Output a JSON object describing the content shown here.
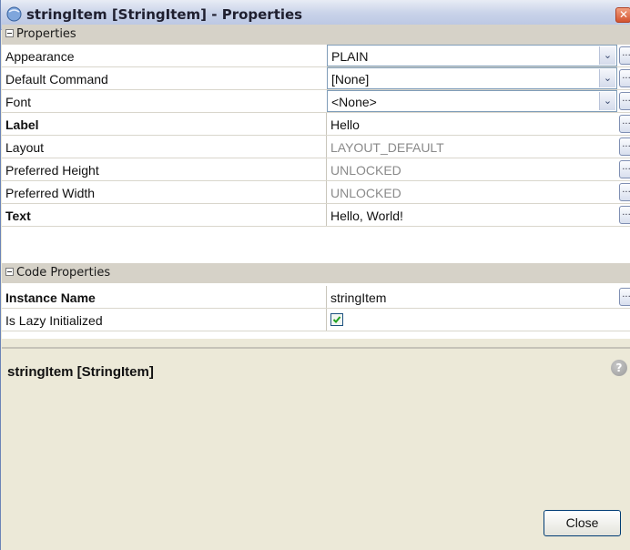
{
  "window": {
    "title": "stringItem [StringItem] - Properties",
    "close_glyph": "✕"
  },
  "sections": {
    "properties": "Properties",
    "code_properties": "Code Properties"
  },
  "properties": [
    {
      "name": "Appearance",
      "value": "PLAIN"
    },
    {
      "name": "Default Command",
      "value": "[None]"
    },
    {
      "name": "Font",
      "value": "<None>"
    },
    {
      "name": "Label",
      "value": "Hello"
    },
    {
      "name": "Layout",
      "value": "LAYOUT_DEFAULT"
    },
    {
      "name": "Preferred Height",
      "value": "UNLOCKED"
    },
    {
      "name": "Preferred Width",
      "value": "UNLOCKED"
    },
    {
      "name": "Text",
      "value": "Hello, World!"
    }
  ],
  "code_properties": [
    {
      "name": "Instance Name",
      "value": "stringItem"
    },
    {
      "name": "Is Lazy Initialized",
      "checked": true
    }
  ],
  "help": {
    "title": "stringItem [StringItem]",
    "icon_glyph": "?"
  },
  "ellipsis_label": "...",
  "dropdown_glyph": "⌄",
  "buttons": {
    "close": "Close"
  },
  "colors": {
    "panel_background": "#ece9d8",
    "category_background": "#d6d2c8",
    "grey_value_text": "#8a8a8a"
  }
}
